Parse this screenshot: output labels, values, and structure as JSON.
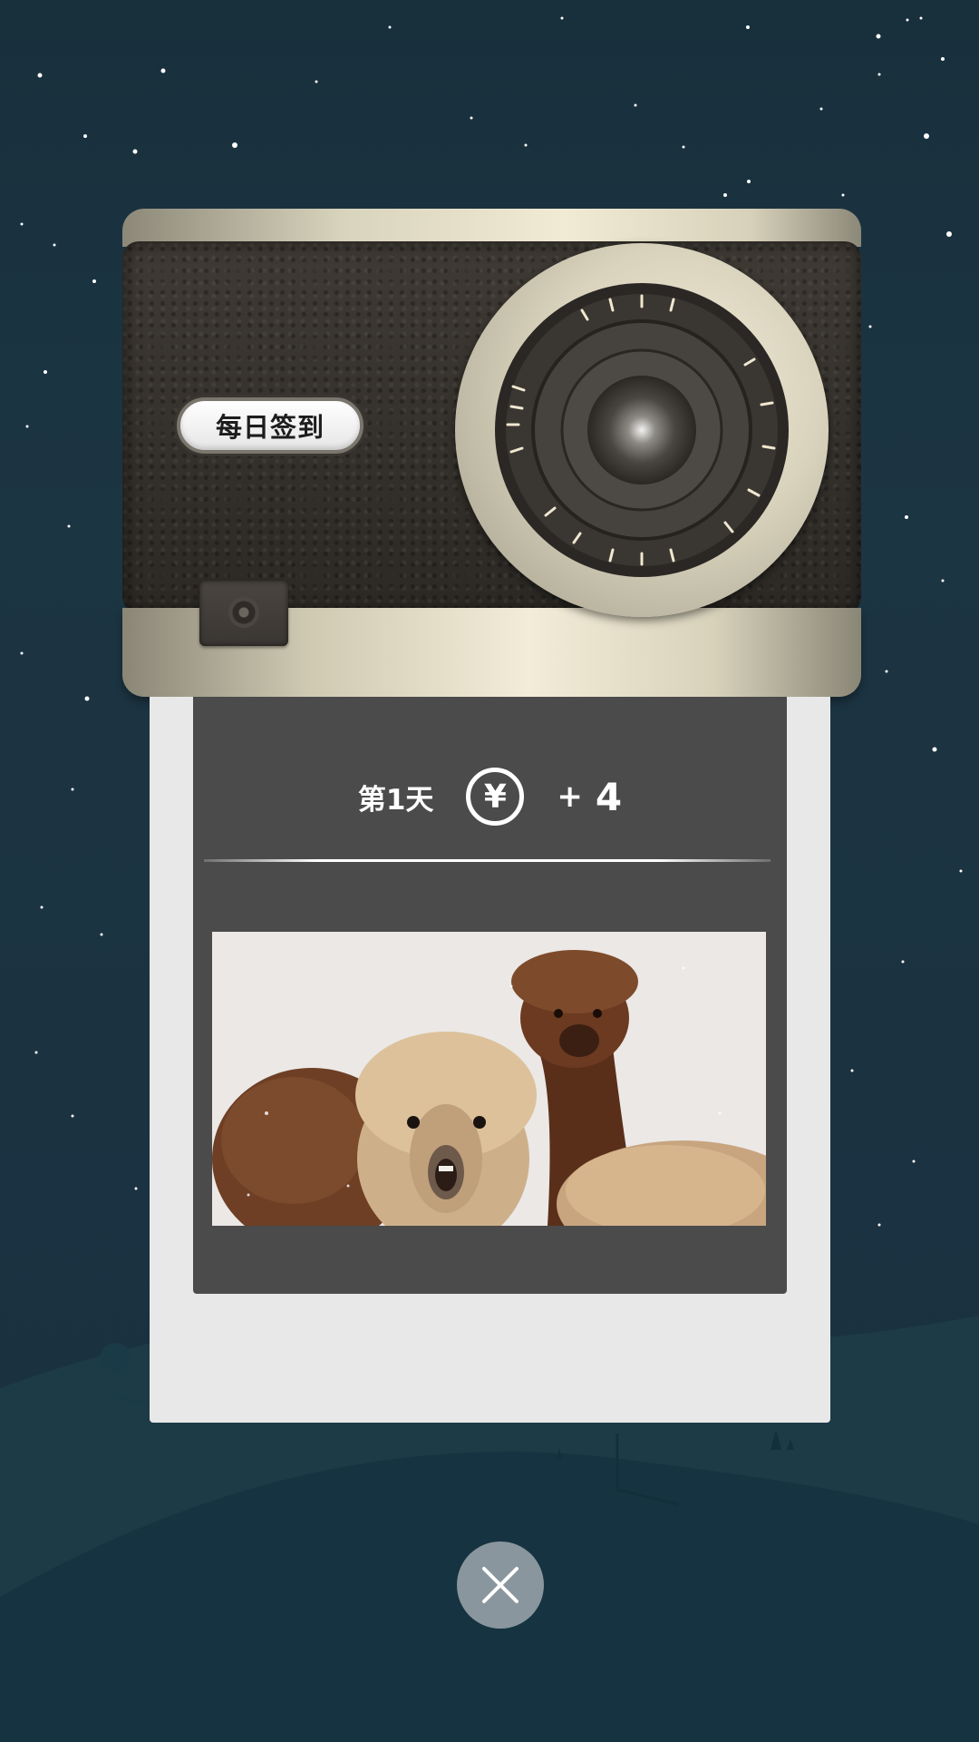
{
  "checkin": {
    "button_label": "每日签到"
  },
  "reward": {
    "day_label": "第1天",
    "currency_icon": "yuan-coin-icon",
    "currency_symbol": "¥",
    "plus": "+",
    "amount": "4"
  },
  "photo": {
    "subject": "alpacas-in-snow"
  },
  "close": {
    "icon": "close-icon"
  },
  "colors": {
    "background": "#1b3341",
    "card": "#e8e8e8",
    "card_inner": "#4b4b4b",
    "close_button": "#8a969d"
  }
}
